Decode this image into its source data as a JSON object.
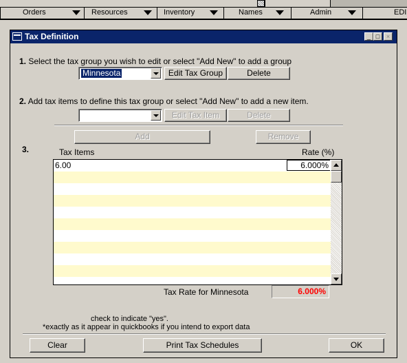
{
  "menubar": {
    "items": [
      {
        "label": "Orders",
        "has_arrow": true
      },
      {
        "label": "Resources",
        "has_arrow": true
      },
      {
        "label": "Inventory",
        "has_arrow": true
      },
      {
        "label": "Names",
        "has_arrow": true
      },
      {
        "label": "Admin",
        "has_arrow": true
      },
      {
        "label": "EDI",
        "has_arrow": false
      }
    ]
  },
  "window": {
    "title": "Tax Definition",
    "controls": {
      "minimize": "_",
      "maximize": "□",
      "close": "×"
    }
  },
  "step1": {
    "number": "1.",
    "text": "Select the tax group you wish to edit or select \"Add New\" to add a group",
    "group_value": "Minnesota",
    "edit_label": "Edit Tax Group",
    "delete_label": "Delete"
  },
  "step2": {
    "number": "2.",
    "text": "Add tax items to define this tax group or select \"Add New\" to add a new item.",
    "item_value": "",
    "edit_label": "Edit Tax Item",
    "delete_label": "Delete",
    "add_label": "Add",
    "remove_label": "Remove"
  },
  "step3": {
    "number": "3.",
    "col_items": "Tax Items",
    "col_rate": "Rate (%)",
    "rows": [
      {
        "name": "6.00",
        "rate": "6.000%"
      }
    ],
    "total_label": "Tax Rate for Minnesota",
    "total_value": "6.000%"
  },
  "notes": {
    "line1": "check to indicate \"yes\".",
    "line2": "*exactly as it appear in quickbooks if you intend to export data"
  },
  "footer": {
    "clear_label": "Clear",
    "print_label": "Print Tax Schedules",
    "ok_label": "OK"
  },
  "colors": {
    "titlebar": "#0a246a",
    "row_alt": "#fffacd",
    "total_text": "#ff0000"
  }
}
